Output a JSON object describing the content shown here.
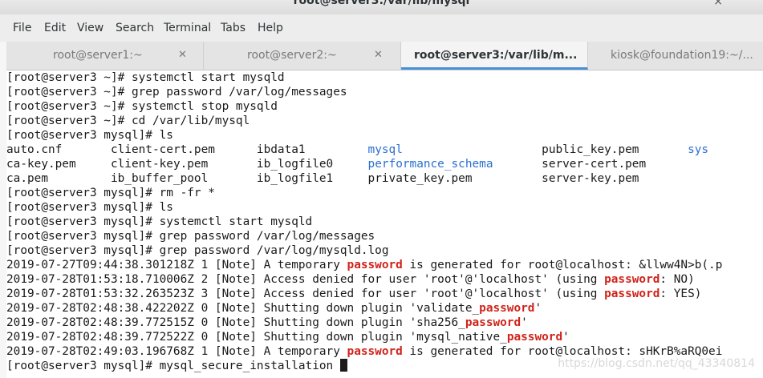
{
  "window": {
    "title": "root@server3:/var/lib/mysql"
  },
  "menu": [
    "File",
    "Edit",
    "View",
    "Search",
    "Terminal",
    "Tabs",
    "Help"
  ],
  "tabs": [
    {
      "label": "root@server1:~",
      "active": false
    },
    {
      "label": "root@server2:~",
      "active": false
    },
    {
      "label": "root@server3:/var/lib/m...",
      "active": true
    },
    {
      "label": "kiosk@foundation19:~/...",
      "active": false
    }
  ],
  "terminal": {
    "lines": [
      "[root@server3 ~]# systemctl start mysqld",
      "[root@server3 ~]# grep password /var/log/messages",
      "[root@server3 ~]# systemctl stop mysqld",
      "[root@server3 ~]# cd /var/lib/mysql",
      "[root@server3 mysql]# ls"
    ],
    "ls_rows": [
      [
        {
          "t": "auto.cnf"
        },
        {
          "t": "client-cert.pem"
        },
        {
          "t": "ibdata1"
        },
        {
          "t": "mysql",
          "dir": true
        },
        {
          "t": "public_key.pem"
        },
        {
          "t": "sys",
          "dir": true
        }
      ],
      [
        {
          "t": "ca-key.pem"
        },
        {
          "t": "client-key.pem"
        },
        {
          "t": "ib_logfile0"
        },
        {
          "t": "performance_schema",
          "dir": true
        },
        {
          "t": "server-cert.pem"
        },
        {
          "t": ""
        }
      ],
      [
        {
          "t": "ca.pem"
        },
        {
          "t": "ib_buffer_pool"
        },
        {
          "t": "ib_logfile1"
        },
        {
          "t": "private_key.pem"
        },
        {
          "t": "server-key.pem"
        },
        {
          "t": ""
        }
      ]
    ],
    "lines2": [
      "[root@server3 mysql]# rm -fr *",
      "[root@server3 mysql]# ls",
      "[root@server3 mysql]# systemctl start mysqld",
      "[root@server3 mysql]# grep password /var/log/messages",
      "[root@server3 mysql]# grep password /var/log/mysqld.log"
    ],
    "log": [
      [
        "2019-07-27T09:44:38.301218Z 1 [Note] A temporary ",
        "password",
        " is generated for root@localhost: &llww4N>b(.p"
      ],
      [
        "2019-07-28T01:53:18.710006Z 2 [Note] Access denied for user 'root'@'localhost' (using ",
        "password",
        ": NO)"
      ],
      [
        "2019-07-28T01:53:32.263523Z 3 [Note] Access denied for user 'root'@'localhost' (using ",
        "password",
        ": YES)"
      ],
      [
        "2019-07-28T02:48:38.422202Z 0 [Note] Shutting down plugin 'validate_",
        "password",
        "'"
      ],
      [
        "2019-07-28T02:48:39.772515Z 0 [Note] Shutting down plugin 'sha256_",
        "password",
        "'"
      ],
      [
        "2019-07-28T02:48:39.772522Z 0 [Note] Shutting down plugin 'mysql_native_",
        "password",
        "'"
      ],
      [
        "2019-07-28T02:49:03.196768Z 1 [Note] A temporary ",
        "password",
        " is generated for root@localhost: sHKrB%aRQ0ei"
      ]
    ],
    "prompt_last": "[root@server3 mysql]# mysql_secure_installation "
  },
  "watermark": "https://blog.csdn.net/qq_43340814",
  "colors": {
    "highlight": "#d0231a",
    "directory": "#2a6fd1",
    "active_tab_accent": "#4a90d9"
  }
}
